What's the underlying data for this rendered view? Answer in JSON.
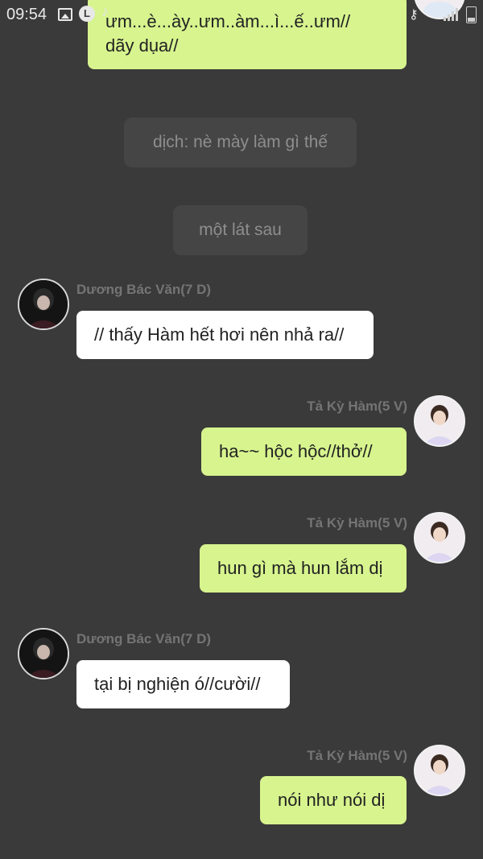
{
  "status_bar": {
    "time": "09:54",
    "l_badge": "L",
    "tiktok_glyph": "♪",
    "key_glyph": "⚷"
  },
  "messages": [
    {
      "type": "sent",
      "text_line1": "ưm...è...ày..ưm..àm...ì...ế..ưm//",
      "text_line2": "dãy dụa//"
    },
    {
      "type": "narration",
      "text": "dịch: nè mày làm gì thế"
    },
    {
      "type": "narration",
      "text": "một lát sau"
    },
    {
      "type": "received",
      "sender": "Dương Bác Văn(7 D)",
      "text": "// thấy Hàm hết hơi nên nhả ra//"
    },
    {
      "type": "sent",
      "sender": "Tả Kỳ Hàm(5 V)",
      "text": "ha~~ hộc hộc//thở//"
    },
    {
      "type": "sent",
      "sender": "Tả Kỳ Hàm(5 V)",
      "text": "hun gì mà hun lắm dị"
    },
    {
      "type": "received",
      "sender": "Dương Bác Văn(7 D)",
      "text": "tại bị nghiện ó//cười//"
    },
    {
      "type": "sent",
      "sender": "Tả Kỳ Hàm(5 V)",
      "text": "nói như nói dị"
    }
  ],
  "colors": {
    "background": "#3a3a3a",
    "sent_bubble": "#d7f48e",
    "received_bubble": "#ffffff",
    "narration_bg": "#454545"
  }
}
